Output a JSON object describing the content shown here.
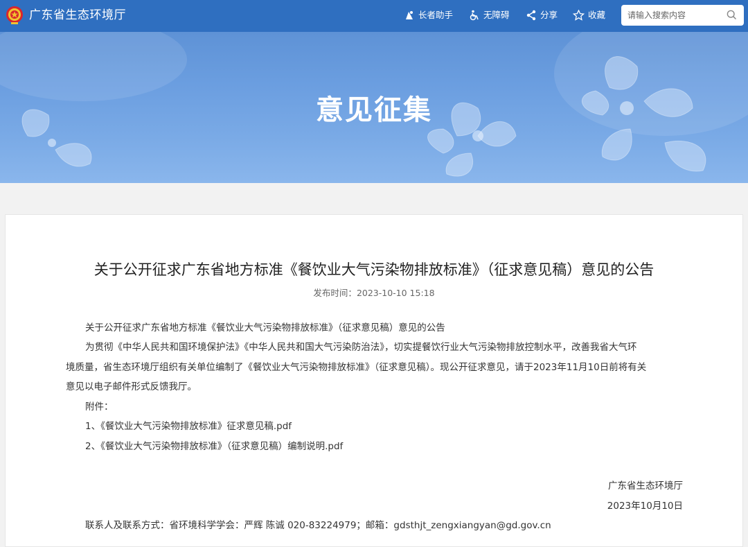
{
  "header": {
    "site_name": "广东省生态环境厅",
    "tools": {
      "elder": "长者助手",
      "accessible": "无障碍",
      "share": "分享",
      "favorite": "收藏"
    },
    "search": {
      "placeholder": "请输入搜索内容"
    }
  },
  "banner": {
    "title": "意见征集"
  },
  "article": {
    "title": "关于公开征求广东省地方标准《餐饮业大气污染物排放标准》（征求意见稿）意见的公告",
    "publish_label": "发布时间：",
    "publish_time": "2023-10-10 15:18",
    "para1": "关于公开征求广东省地方标准《餐饮业大气污染物排放标准》（征求意见稿）意见的公告",
    "para2_line1": "为贯彻《中华人民共和国环境保护法》《中华人民共和国大气污染防治法》，切实提餐饮行业大气污染物排放控制水平，改善我省大气环",
    "para2_line2": "境质量，省生态环境厅组织有关单位编制了《餐饮业大气污染物排放标准》（征求意见稿）。现公开征求意见，请于2023年11月10日前将有关",
    "para2_line3": "意见以电子邮件形式反馈我厅。",
    "attachments_label": "附件：",
    "attachments": [
      "1、《餐饮业大气污染物排放标准》征求意见稿.pdf",
      "2、《餐饮业大气污染物排放标准》（征求意见稿）编制说明.pdf"
    ],
    "signature_org": "广东省生态环境厅",
    "signature_date": "2023年10月10日",
    "contact": "联系人及联系方式：省环境科学学会：严辉 陈诚 020-83224979；邮箱：gdsthjt_zengxiangyan@gd.gov.cn"
  },
  "colors": {
    "header_bg": "#2f6fc0",
    "banner_bg": "#6b9ee0",
    "page_bg": "#f2f2f2"
  }
}
